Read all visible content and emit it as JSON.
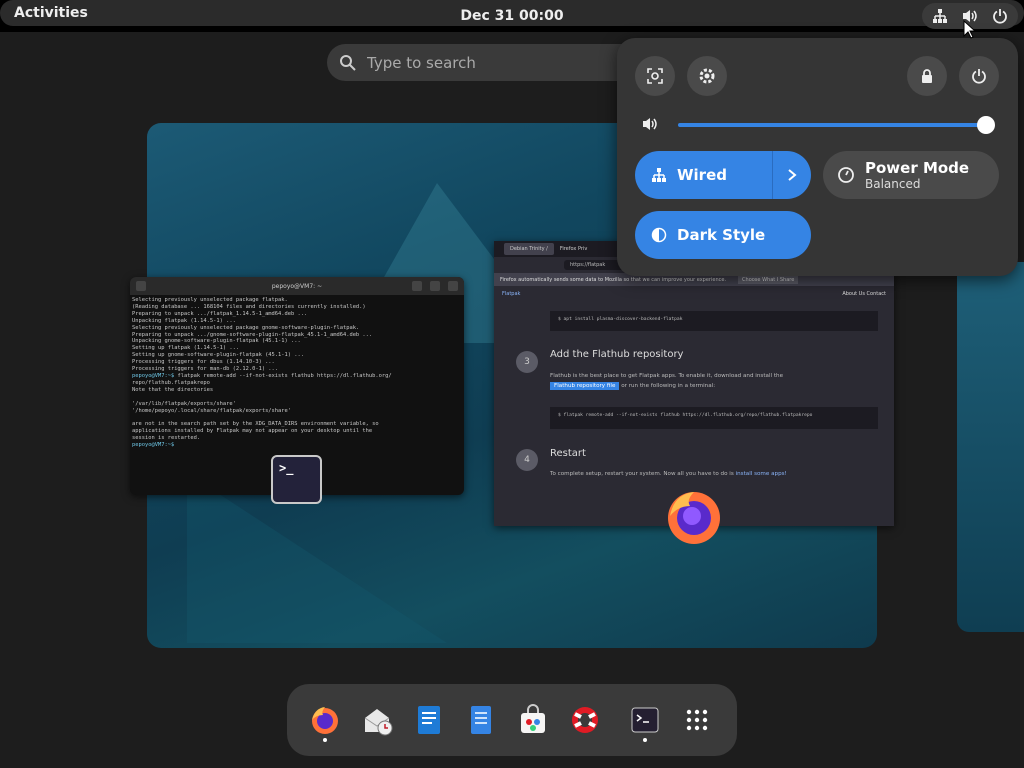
{
  "topbar": {
    "activities_label": "Activities",
    "clock": "Dec 31  00:00",
    "status_icons": [
      "network-wired-icon",
      "volume-icon",
      "power-icon"
    ]
  },
  "search": {
    "placeholder": "Type to search"
  },
  "terminal_preview": {
    "title": "pepoyo@VM7: ~",
    "lines": [
      "Selecting previously unselected package flatpak.",
      "(Reading database ... 168104 files and directories currently installed.)",
      "Preparing to unpack .../flatpak_1.14.5-1_amd64.deb ...",
      "Unpacking flatpak (1.14.5-1) ...",
      "Selecting previously unselected package gnome-software-plugin-flatpak.",
      "Preparing to unpack .../gnome-software-plugin-flatpak_45.1-1_amd64.deb ...",
      "Unpacking gnome-software-plugin-flatpak (45.1-1) ...",
      "Setting up flatpak (1.14.5-1) ...",
      "Setting up gnome-software-plugin-flatpak (45.1-1) ...",
      "Processing triggers for dbus (1.14.10-3) ...",
      "Processing triggers for man-db (2.12.0-1) ..."
    ],
    "prompt": "pepoyo@VM7:~$",
    "command": " flatpak remote-add --if-not-exists flathub https://dl.flathub.org/",
    "command_cont": "repo/flathub.flatpakrepo",
    "note_lines": [
      "Note that the directories",
      "",
      "'/var/lib/flatpak/exports/share'",
      "'/home/pepoyo/.local/share/flatpak/exports/share'",
      "",
      "are not in the search path set by the XDG_DATA_DIRS environment variable, so",
      "applications installed by Flatpak may not appear on your desktop until the",
      "session is restarted."
    ],
    "final_prompt": "pepoyo@VM7:~$ "
  },
  "firefox_preview": {
    "tabs": [
      "Debian Trinity /",
      "Firefox Priv"
    ],
    "url": "https://flatpak",
    "notice": "Firefox automatically sends some data to Mozilla so that we can improve your experience.",
    "notice_button": "Choose What I Share",
    "site_name": "Flatpak",
    "site_nav": "About Us  Contact",
    "code1": "$ apt install plasma-discover-backend-flatpak",
    "step3_num": "3",
    "step3_title": "Add the Flathub repository",
    "step3_text_a": "Flathub is the best place to get Flatpak apps. To enable it, download and install the",
    "step3_button": "Flathub repository file",
    "step3_text_b": "or run the following in a terminal:",
    "code2": "$ flatpak remote-add --if-not-exists flathub https://dl.flathub.org/repo/flathub.flatpakrepo",
    "step4_num": "4",
    "step4_title": "Restart",
    "step4_text": "To complete setup, restart your system. Now all you have to do is",
    "step4_link": "install some apps!"
  },
  "quick_settings": {
    "buttons": [
      "screenshot-icon",
      "settings-icon",
      "lock-icon",
      "power-icon"
    ],
    "volume_level": 1.0,
    "wired_label": "Wired",
    "power_mode_label": "Power Mode",
    "power_mode_value": "Balanced",
    "dark_style_label": "Dark Style",
    "accent_color": "#3584e4"
  },
  "dash": {
    "apps": [
      "firefox",
      "evolution",
      "libreoffice-writer",
      "text-editor",
      "software",
      "help",
      "terminal",
      "app-grid"
    ]
  }
}
